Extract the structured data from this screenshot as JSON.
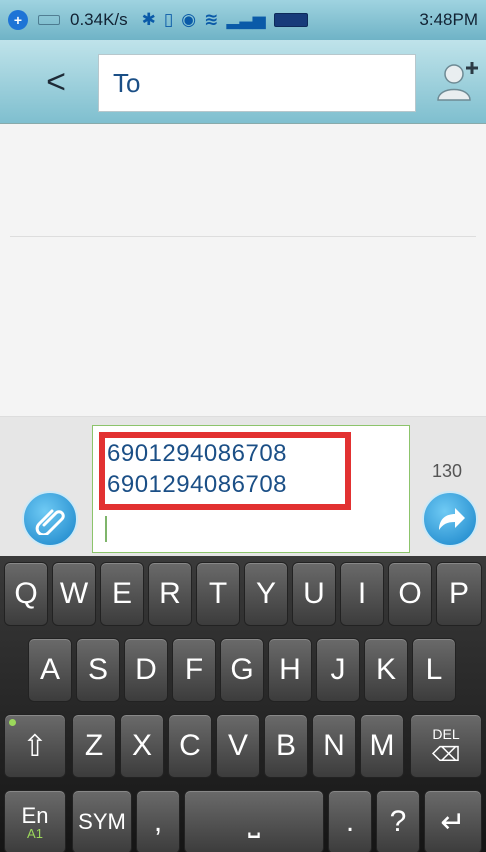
{
  "status_bar": {
    "speed": "0.34K/s",
    "time": "3:48PM",
    "icons": [
      "globe-icon",
      "keyboard-indicator-icon",
      "bluetooth-icon",
      "vibrate-icon",
      "sync-icon",
      "wifi-icon",
      "signal-icon",
      "battery-icon"
    ]
  },
  "header": {
    "back_label": "<",
    "to_label": "To"
  },
  "compose": {
    "line1": "6901294086708",
    "line2": "6901294086708",
    "char_count": "130"
  },
  "keyboard": {
    "row1": [
      "Q",
      "W",
      "E",
      "R",
      "T",
      "Y",
      "U",
      "I",
      "O",
      "P"
    ],
    "row2": [
      "A",
      "S",
      "D",
      "F",
      "G",
      "H",
      "J",
      "K",
      "L"
    ],
    "row3": [
      "Z",
      "X",
      "C",
      "V",
      "B",
      "N",
      "M"
    ],
    "shift_label": "⇧",
    "del_label": "DEL",
    "en_label": "En",
    "a1_label": "A1",
    "sym_label": "SYM",
    "comma_label": ",",
    "space_label": "⎵",
    "period_label": ".",
    "question_label": "?",
    "enter_label": "↵"
  },
  "colors": {
    "accent": "#1682c8",
    "highlight": "#e23131",
    "text_blue": "#1b4f86"
  }
}
